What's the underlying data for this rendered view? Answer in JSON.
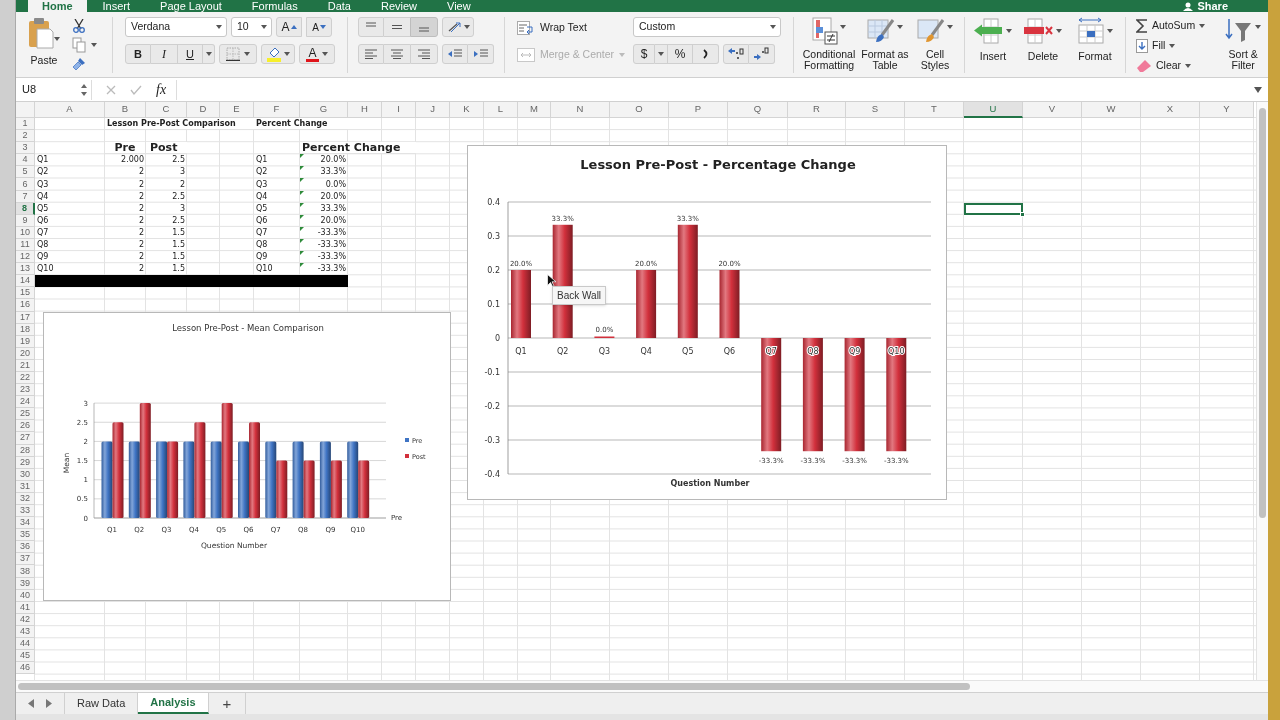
{
  "ribbon_tabs": [
    {
      "label": "Home",
      "selected": true
    },
    {
      "label": "Insert",
      "selected": false
    },
    {
      "label": "Page Layout",
      "selected": false
    },
    {
      "label": "Formulas",
      "selected": false
    },
    {
      "label": "Data",
      "selected": false
    },
    {
      "label": "Review",
      "selected": false
    },
    {
      "label": "View",
      "selected": false
    }
  ],
  "share_button": "Share",
  "ribbon": {
    "paste": "Paste",
    "font_name": "Verdana",
    "font_size": "10",
    "grow_font": "A",
    "shrink_font": "A",
    "bold": "B",
    "italic": "I",
    "underline": "U",
    "font_color": "A",
    "wrap_text": "Wrap Text",
    "merge_center": {
      "label": "Merge & Center",
      "disabled": true
    },
    "number_format": "Custom",
    "currency": "$",
    "percent": "%",
    "conditional_formatting": "Conditional Formatting",
    "format_as_table": "Format as Table",
    "cell_styles": "Cell Styles",
    "insert": "Insert",
    "delete": "Delete",
    "format": "Format",
    "autosum": "AutoSum",
    "fill": "Fill",
    "clear": "Clear",
    "sort_filter": "Sort & Filter"
  },
  "formula_bar": {
    "name_box": "U8",
    "function_label": "fx"
  },
  "sheet": {
    "columns": [
      {
        "label": "A",
        "selected": false
      },
      {
        "label": "B",
        "selected": false
      },
      {
        "label": "C",
        "selected": false
      },
      {
        "label": "D",
        "selected": false
      },
      {
        "label": "E",
        "selected": false
      },
      {
        "label": "F",
        "selected": false
      },
      {
        "label": "G",
        "selected": false
      },
      {
        "label": "H",
        "selected": false
      },
      {
        "label": "I",
        "selected": false
      },
      {
        "label": "J",
        "selected": false
      },
      {
        "label": "K",
        "selected": false
      },
      {
        "label": "L",
        "selected": false
      },
      {
        "label": "M",
        "selected": false
      },
      {
        "label": "N",
        "selected": false
      },
      {
        "label": "O",
        "selected": false
      },
      {
        "label": "P",
        "selected": false
      },
      {
        "label": "Q",
        "selected": false
      },
      {
        "label": "R",
        "selected": false
      },
      {
        "label": "S",
        "selected": false
      },
      {
        "label": "T",
        "selected": false
      },
      {
        "label": "U",
        "selected": true
      },
      {
        "label": "V",
        "selected": false
      },
      {
        "label": "W",
        "selected": false
      },
      {
        "label": "X",
        "selected": false
      },
      {
        "label": "Y",
        "selected": false
      }
    ],
    "rows": [
      {
        "label": "1",
        "selected": false
      },
      {
        "label": "2",
        "selected": false
      },
      {
        "label": "3",
        "selected": false
      },
      {
        "label": "4",
        "selected": false
      },
      {
        "label": "5",
        "selected": false
      },
      {
        "label": "6",
        "selected": false
      },
      {
        "label": "7",
        "selected": false
      },
      {
        "label": "8",
        "selected": true
      },
      {
        "label": "9",
        "selected": false
      },
      {
        "label": "10",
        "selected": false
      },
      {
        "label": "11",
        "selected": false
      },
      {
        "label": "12",
        "selected": false
      },
      {
        "label": "13",
        "selected": false
      },
      {
        "label": "14",
        "selected": false
      },
      {
        "label": "15",
        "selected": false
      },
      {
        "label": "16",
        "selected": false
      },
      {
        "label": "17",
        "selected": false
      },
      {
        "label": "18",
        "selected": false
      },
      {
        "label": "19",
        "selected": false
      },
      {
        "label": "20",
        "selected": false
      },
      {
        "label": "21",
        "selected": false
      },
      {
        "label": "22",
        "selected": false
      },
      {
        "label": "23",
        "selected": false
      },
      {
        "label": "24",
        "selected": false
      },
      {
        "label": "25",
        "selected": false
      },
      {
        "label": "26",
        "selected": false
      },
      {
        "label": "27",
        "selected": false
      },
      {
        "label": "28",
        "selected": false
      },
      {
        "label": "29",
        "selected": false
      },
      {
        "label": "30",
        "selected": false
      },
      {
        "label": "31",
        "selected": false
      },
      {
        "label": "32",
        "selected": false
      },
      {
        "label": "33",
        "selected": false
      },
      {
        "label": "34",
        "selected": false
      },
      {
        "label": "35",
        "selected": false
      },
      {
        "label": "36",
        "selected": false
      },
      {
        "label": "37",
        "selected": false
      },
      {
        "label": "38",
        "selected": false
      },
      {
        "label": "39",
        "selected": false
      },
      {
        "label": "40",
        "selected": false
      },
      {
        "label": "41",
        "selected": false
      },
      {
        "label": "42",
        "selected": false
      },
      {
        "label": "43",
        "selected": false
      },
      {
        "label": "44",
        "selected": false
      },
      {
        "label": "45",
        "selected": false
      },
      {
        "label": "46",
        "selected": false
      }
    ],
    "title_row": {
      "b": "Lesson Pre-Post Comparison",
      "f": "Percent Change"
    },
    "header_row": {
      "b": "Pre",
      "c": "Post",
      "g": "Percent Change"
    },
    "data": [
      {
        "a": "Q1",
        "b": "2.000",
        "c": "2.5",
        "f": "Q1",
        "g": "20.0%",
        "flag": true
      },
      {
        "a": "Q2",
        "b": "2",
        "c": "3",
        "f": "Q2",
        "g": "33.3%",
        "flag": true
      },
      {
        "a": "Q3",
        "b": "2",
        "c": "2",
        "f": "Q3",
        "g": "0.0%",
        "flag": true
      },
      {
        "a": "Q4",
        "b": "2",
        "c": "2.5",
        "f": "Q4",
        "g": "20.0%",
        "flag": true
      },
      {
        "a": "Q5",
        "b": "2",
        "c": "3",
        "f": "Q5",
        "g": "33.3%",
        "flag": true
      },
      {
        "a": "Q6",
        "b": "2",
        "c": "2.5",
        "f": "Q6",
        "g": "20.0%",
        "flag": true
      },
      {
        "a": "Q7",
        "b": "2",
        "c": "1.5",
        "f": "Q7",
        "g": "-33.3%",
        "flag": true
      },
      {
        "a": "Q8",
        "b": "2",
        "c": "1.5",
        "f": "Q8",
        "g": "-33.3%",
        "flag": true
      },
      {
        "a": "Q9",
        "b": "2",
        "c": "1.5",
        "f": "Q9",
        "g": "-33.3%",
        "flag": true
      },
      {
        "a": "Q10",
        "b": "2",
        "c": "1.5",
        "f": "Q10",
        "g": "-33.3%",
        "flag": true
      }
    ]
  },
  "charts": [
    {
      "chart_data": {
        "type": "bar",
        "title": "Lesson Pre-Post - Mean Comparison",
        "xlabel": "Question Number",
        "ylabel": "Mean",
        "categories": [
          "Q1",
          "Q2",
          "Q3",
          "Q4",
          "Q5",
          "Q6",
          "Q7",
          "Q8",
          "Q9",
          "Q10"
        ],
        "series": [
          {
            "name": "Pre",
            "color": "#3f74c4",
            "values": [
              2,
              2,
              2,
              2,
              2,
              2,
              2,
              2,
              2,
              2
            ]
          },
          {
            "name": "Post",
            "color": "#d2303c",
            "values": [
              2.5,
              3,
              2,
              2.5,
              3,
              2.5,
              1.5,
              1.5,
              1.5,
              1.5
            ]
          }
        ],
        "ylim": [
          0,
          3
        ],
        "yticks": [
          0,
          0.5,
          1,
          1.5,
          2,
          2.5,
          3
        ],
        "grid": true,
        "legend": "right"
      },
      "depth_label": "Pre"
    },
    {
      "chart_data": {
        "type": "bar",
        "title": "Lesson Pre-Post - Percentage Change",
        "xlabel": "Question Number",
        "categories": [
          "Q1",
          "Q2",
          "Q3",
          "Q4",
          "Q5",
          "Q6",
          "Q7",
          "Q8",
          "Q9",
          "Q10"
        ],
        "series": [
          {
            "color": "#d2303c",
            "values": [
              0.2,
              0.333,
              0,
              0.2,
              0.333,
              0.2,
              -0.333,
              -0.333,
              -0.333,
              -0.333
            ]
          }
        ],
        "ylim": [
          -0.4,
          0.4
        ],
        "yticks": [
          -0.4,
          -0.3,
          -0.2,
          -0.1,
          0,
          0.1,
          0.2,
          0.3,
          0.4
        ],
        "value_labels": [
          "20.0%",
          "33.3%",
          "0.0%",
          "20.0%",
          "33.3%",
          "20.0%",
          "-33.3%",
          "-33.3%",
          "-33.3%",
          "-33.3%"
        ],
        "grid": true
      },
      "tooltip": "Back Wall"
    }
  ],
  "sheet_tabs": [
    {
      "label": "Raw Data",
      "selected": false
    },
    {
      "label": "Analysis",
      "selected": true
    }
  ],
  "add_sheet": "+"
}
